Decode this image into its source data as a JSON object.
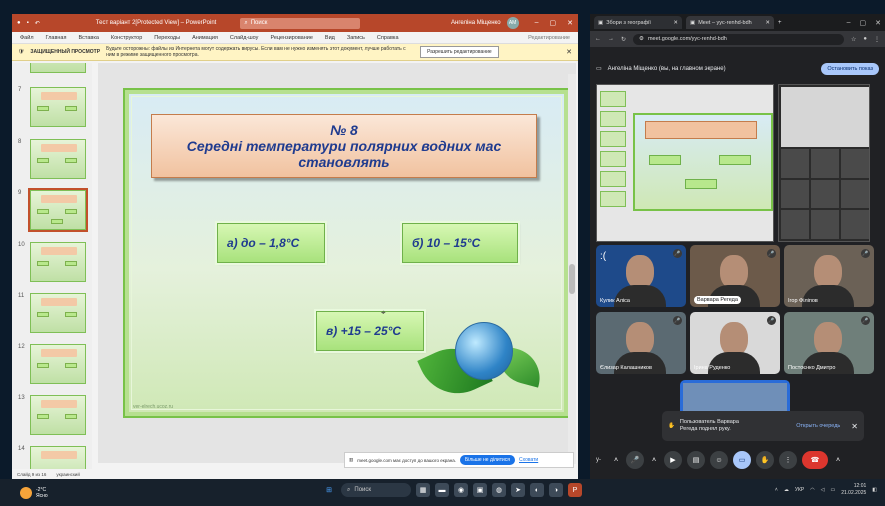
{
  "ppt": {
    "window_title": "Тест варіант 2[Protected View] – PowerPoint",
    "search_placeholder": "Поиск",
    "user_name": "Ангеліна Міщенко",
    "user_initials": "АМ",
    "menu": [
      "Файл",
      "Главная",
      "Вставка",
      "Конструктор",
      "Переходы",
      "Анимация",
      "Слайд-шоу",
      "Рецензирование",
      "Вид",
      "Запись",
      "Справка"
    ],
    "menu_right": "Редактирование",
    "protected": {
      "label": "ЗАЩИЩЕННЫЙ ПРОСМОТР",
      "message": "Будьте осторожны: файлы из Интернета могут содержать вирусы. Если вам не нужно изменять этот документ, лучше работать с ним в режиме защищенного просмотра.",
      "button": "Разрешить редактирование"
    },
    "thumbnails": [
      "7",
      "8",
      "9",
      "10",
      "11",
      "12",
      "13",
      "14"
    ],
    "selected_thumbnail": "9",
    "slide": {
      "number": "№ 8",
      "question": "Середні температури полярних водних мас становлять",
      "answer_a": "а) до – 1,8°С",
      "answer_b": "б) 10 – 15°С",
      "answer_c": "в) +15 – 25°С",
      "watermark": "ver-elrech.ucoz.ru"
    },
    "status": {
      "slide_counter": "Слайд 9 из 16",
      "language": "украинский"
    },
    "share_bar": {
      "message": "meet.google.com має доступ до вашого екрана.",
      "stop": "Більше не ділитися",
      "hide": "Сховати"
    }
  },
  "chrome": {
    "tabs": [
      {
        "label": "Збори з географії"
      },
      {
        "label": "Meet – yyc-renhd-bdh"
      }
    ],
    "url": "meet.google.com/yyc-renhd-bdh",
    "presenter_bar": {
      "text": "Ангеліна Міщенко (вы, на главном экране)",
      "button": "Остановить показ"
    },
    "participants": [
      {
        "name": "Кулик Аліса"
      },
      {
        "name": "Варвара Регеда"
      },
      {
        "name": "Ігор Філіпов"
      },
      {
        "name": "Єлизар Калашников"
      },
      {
        "name": "Ірина Руденко"
      },
      {
        "name": "Постоєнко Дмитро"
      }
    ],
    "sad_emoticon": ":(",
    "toast": {
      "text": "Пользователь Варвара Регеда поднял руку.",
      "link": "Открыть очередь"
    },
    "controls": {
      "label": "y-"
    }
  },
  "taskbar": {
    "weather_temp": "-2°C",
    "weather_desc": "Ясно",
    "search": "Поиск",
    "lang": "УКР",
    "time": "12:01",
    "date": "21.02.2025"
  }
}
